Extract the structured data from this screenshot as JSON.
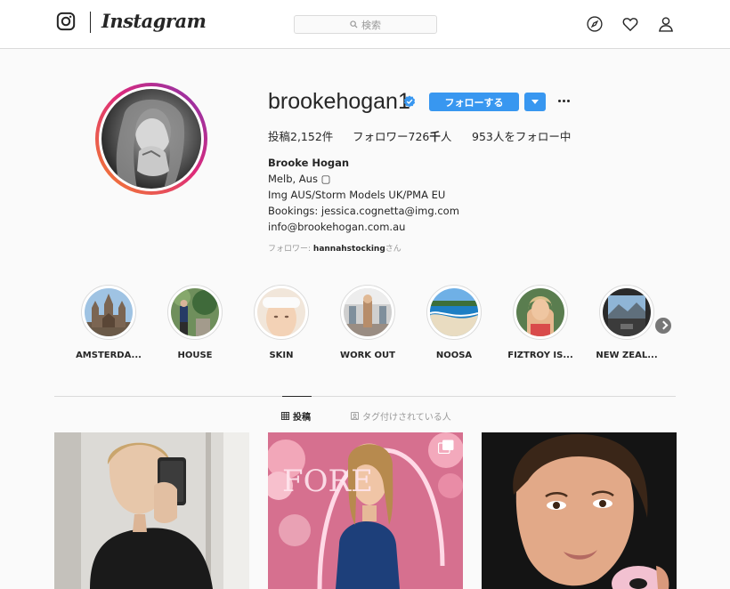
{
  "header": {
    "brand": "Instagram",
    "search_placeholder": "検索",
    "icons": [
      "instagram-logo-icon",
      "search-icon",
      "compass-icon",
      "heart-icon",
      "user-icon"
    ]
  },
  "profile": {
    "username": "brookehogan1",
    "verified": true,
    "follow_label": "フォローする",
    "stats": {
      "posts": "投稿2,152件",
      "followers_prefix": "フォロワー726",
      "followers_bold": "千",
      "followers_suffix": "人",
      "following": "953人をフォロー中"
    },
    "bio": {
      "name": "Brooke Hogan",
      "lines": [
        "Melb, Aus ▢",
        "Img AUS/Storm Models UK/PMA EU",
        "Bookings: jessica.cognetta@img.com",
        "info@brookehogan.com.au"
      ]
    },
    "followed_by": {
      "prefix": "フォロワー: ",
      "user": "hannahstocking",
      "suffix": "さん"
    }
  },
  "highlights": [
    {
      "label": "AMSTERDA..."
    },
    {
      "label": "HOUSE"
    },
    {
      "label": "SKIN"
    },
    {
      "label": "WORK OUT"
    },
    {
      "label": "NOOSA"
    },
    {
      "label": "FIZTROY IS..."
    },
    {
      "label": "NEW ZEAL..."
    }
  ],
  "tabs": {
    "posts": "投稿",
    "tagged": "タグ付けされている人"
  },
  "posts": [
    {
      "type": "photo"
    },
    {
      "type": "carousel",
      "sign_text": "FORE"
    },
    {
      "type": "photo"
    }
  ],
  "colors": {
    "accent": "#3897f0",
    "text": "#262626",
    "muted": "#999999",
    "border": "#dbdbdb",
    "background": "#fafafa"
  }
}
